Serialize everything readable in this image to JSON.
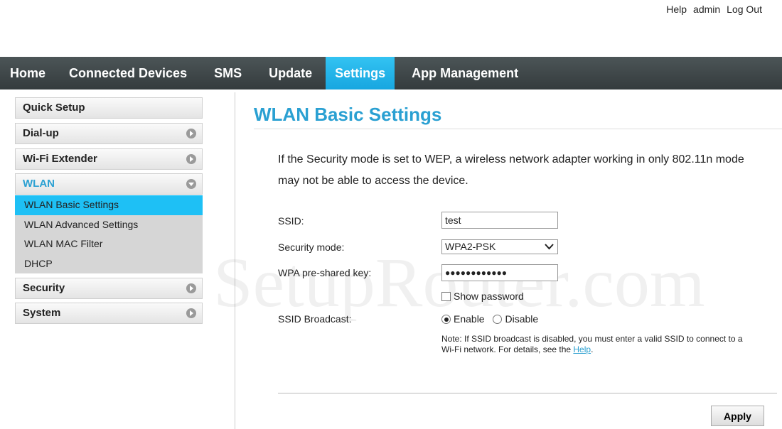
{
  "top_links": {
    "help": "Help",
    "user": "admin",
    "logout": "Log Out"
  },
  "nav": {
    "items": [
      "Home",
      "Connected Devices",
      "SMS",
      "Update",
      "Settings",
      "App Management"
    ],
    "active": "Settings"
  },
  "sidebar": {
    "quick_setup": "Quick Setup",
    "dialup": "Dial-up",
    "wifi_extender": "Wi-Fi Extender",
    "wlan": "WLAN",
    "wlan_sub": [
      "WLAN Basic Settings",
      "WLAN Advanced Settings",
      "WLAN MAC Filter",
      "DHCP"
    ],
    "security": "Security",
    "system": "System"
  },
  "main": {
    "title": "WLAN Basic Settings",
    "info": "If the Security mode is set to WEP, a wireless network adapter working in only 802.11n mode may not be able to access the device.",
    "ssid_label": "SSID:",
    "ssid_value": "test",
    "security_label": "Security mode:",
    "security_value": "WPA2-PSK",
    "psk_label": "WPA pre-shared key:",
    "psk_value": "●●●●●●●●●●●●",
    "show_password": "Show password",
    "broadcast_label": "SSID Broadcast:",
    "enable": "Enable",
    "disable": "Disable",
    "broadcast_selected": "Enable",
    "note": "Note: If SSID broadcast is disabled, you must enter a valid SSID to connect to a Wi-Fi network. For details, see the ",
    "note_link": "Help",
    "note_end": ".",
    "apply": "Apply"
  },
  "watermark": "SetupRouter.com",
  "colors": {
    "accent": "#1ec0f5",
    "title": "#2aa0d2",
    "nav_bg": "#3d4446"
  }
}
